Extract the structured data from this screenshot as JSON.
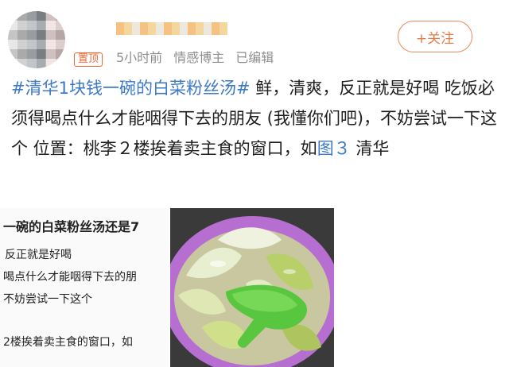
{
  "header": {
    "pin_label": "置顶",
    "time": "5小时前",
    "role": "情感博主",
    "edited": "已编辑",
    "follow_label": "+关注"
  },
  "post": {
    "topic": "#清华1块钱一碗的白菜粉丝汤#",
    "text_1": " 鲜，清爽，反正就是好喝 吃饭必须得喝点什么才能咽得下去的朋友 (我懂你们吧)，不妨尝试一下这个 位置：桃李２楼挨着卖主食的窗口，如",
    "link": "图３",
    "text_2": " 清华"
  },
  "image_left": {
    "line_1": "一碗的白菜粉丝汤还是7",
    "line_2": "反正就是好喝",
    "line_3": "喝点什么才能咽得下去的朋",
    "line_4": "不妨尝试一下这个",
    "line_5": "2楼挨着卖主食的窗口，如"
  },
  "colors": {
    "topic_link": "#3c79c7",
    "accent_orange": "#e67c45",
    "meta_gray": "#8e8e8e",
    "bowl_purple": "#b66fd1",
    "spoon_green": "#58c63e"
  }
}
